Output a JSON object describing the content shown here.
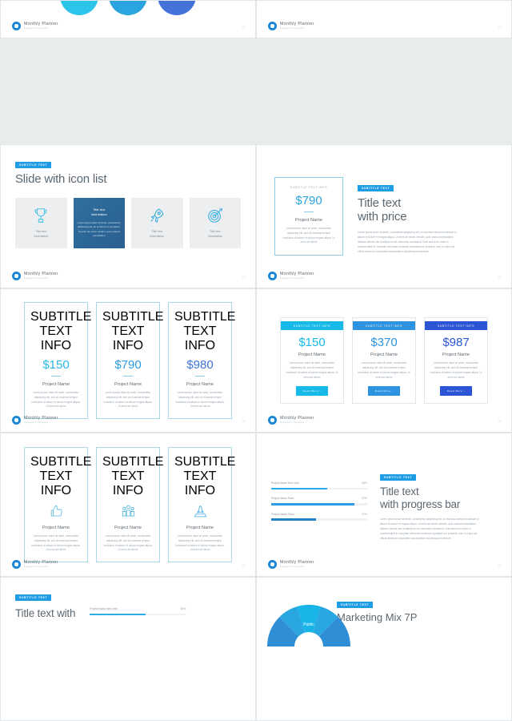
{
  "theme": {
    "accent_cyan": "#00AEEF",
    "accent_blue": "#1E9CE5",
    "accent_royal": "#2B5FD9",
    "text_dark": "#5B6771",
    "text_muted": "#9AA6B0",
    "card_bg": "#ECEEF0"
  },
  "footer": {
    "brand": "Monthly Planner",
    "tagline": "Powerpoint Template",
    "logo_icon": "hexagon-logo-icon"
  },
  "lorem": {
    "short": "Lorem ipsum dolor sit amet, consectetur adipiscing elit, sed do eiusmod tempor incididunt ut labore et dolore magna aliqua. Ut enim ad minim",
    "card": "Lorem ipsum dolor sit amet, consectetur adipiscing elit, sed do eiusmod tempor incididunt ut labore et dolore magna aliqua. Ut enim ad minim",
    "long": "Lorem ipsum dolor sit amet, consectetur adipiscing elit, do eiusmod tempor incididunt ut labore et dolore et magna aliqua. Ut enim ad minim veniam, quis nostrud exercitation ullamco laboris nisi ut aliquip ex ea commodo consequat. Duis aute irure dolor in reprehenderit in voluptate velit esse occaecat cupidatat non proident, sunt in culpa qui officia deserunt voluptatem accusantium doloremque inventore",
    "dark_card": "Lorem ipsum dolor sit amet, consectetur adipiscing elit, do et dolore ut ma aliqua. Ut enim ad minim veniam, quis nostrud exercitation"
  },
  "slides": {
    "row0_left": {
      "page": "02",
      "circles": [
        "#2CC4E8",
        "#2BA4E0",
        "#4472D8"
      ]
    },
    "row0_right": {
      "page": "03"
    },
    "icon_list": {
      "badge": "SUBTITLE TEXT",
      "title": "Slide with icon list",
      "page": "04",
      "cards": [
        {
          "icon": "trophy-icon",
          "label": "Title text\nInformation",
          "active": false
        },
        {
          "icon": "text-block",
          "label": "Title text\nInformation",
          "active": true
        },
        {
          "icon": "rocket-icon",
          "label": "Title text\nInformation",
          "active": false
        },
        {
          "icon": "target-icon",
          "label": "Title text\nInformation",
          "active": false
        }
      ]
    },
    "price_single": {
      "badge": "SUBTITLE TEXT",
      "title_line1": "Title text",
      "title_line2": "with price",
      "page": "05",
      "card": {
        "tag": "SUBTITLE TEXT INFO",
        "amount": "$790",
        "name": "Project Name"
      }
    },
    "price_three": {
      "page": "06",
      "cards": [
        {
          "tag": "SUBTITLE TEXT INFO",
          "amount": "$150",
          "name": "Project Name",
          "color": "#29B6E8"
        },
        {
          "tag": "SUBTITLE TEXT INFO",
          "amount": "$790",
          "name": "Project Name",
          "color": "#2A9BE2"
        },
        {
          "tag": "SUBTITLE TEXT INFO",
          "amount": "$980",
          "name": "Project Name",
          "color": "#3C74D6"
        }
      ]
    },
    "price_header": {
      "page": "07",
      "button_label": "Read More",
      "button_icon": "arrow-right-icon",
      "cards": [
        {
          "tag": "SUBTITLE TEXT INFO",
          "amount": "$150",
          "name": "Project Name",
          "color": "#17B9E8"
        },
        {
          "tag": "SUBTITLE TEXT INFO",
          "amount": "$370",
          "name": "Project Name",
          "color": "#2E93E0"
        },
        {
          "tag": "SUBTITLE TEXT INFO",
          "amount": "$987",
          "name": "Project Name",
          "color": "#2B55D4"
        }
      ]
    },
    "icon_cards": {
      "page": "08",
      "cards": [
        {
          "tag": "SUBTITLE TEXT INFO",
          "icon": "thumbs-up-icon",
          "name": "Project Name"
        },
        {
          "tag": "SUBTITLE TEXT INFO",
          "icon": "people-group-icon",
          "name": "Project Name"
        },
        {
          "tag": "SUBTITLE TEXT INFO",
          "icon": "laptop-rocket-icon",
          "name": "Project Name"
        }
      ]
    },
    "progress": {
      "badge": "SUBTITLE TEXT",
      "title_line1": "Title text",
      "title_line2": "with progress bar",
      "page": "09",
      "bars": [
        {
          "label": "Project Name New York",
          "percent": "58%",
          "value": 58,
          "color": "#2BAEE8"
        },
        {
          "label": "Project Name Paris",
          "percent": "87%",
          "value": 87,
          "color": "#2B9EE4"
        },
        {
          "label": "Project Name Tokio",
          "percent": "47%",
          "value": 47,
          "color": "#2083C8"
        }
      ]
    },
    "row4_left": {
      "badge": "SUBTITLE TEXT",
      "title": "Title text with",
      "page": "10",
      "bars": [
        {
          "label": "Project Name New York",
          "percent": "58%",
          "value": 58,
          "color": "#2BAEE8"
        }
      ]
    },
    "marketing_mix": {
      "badge": "SUBTITLE TEXT",
      "title": "Marketing Mix 7P",
      "page": "11",
      "pie_label": "Public"
    }
  }
}
